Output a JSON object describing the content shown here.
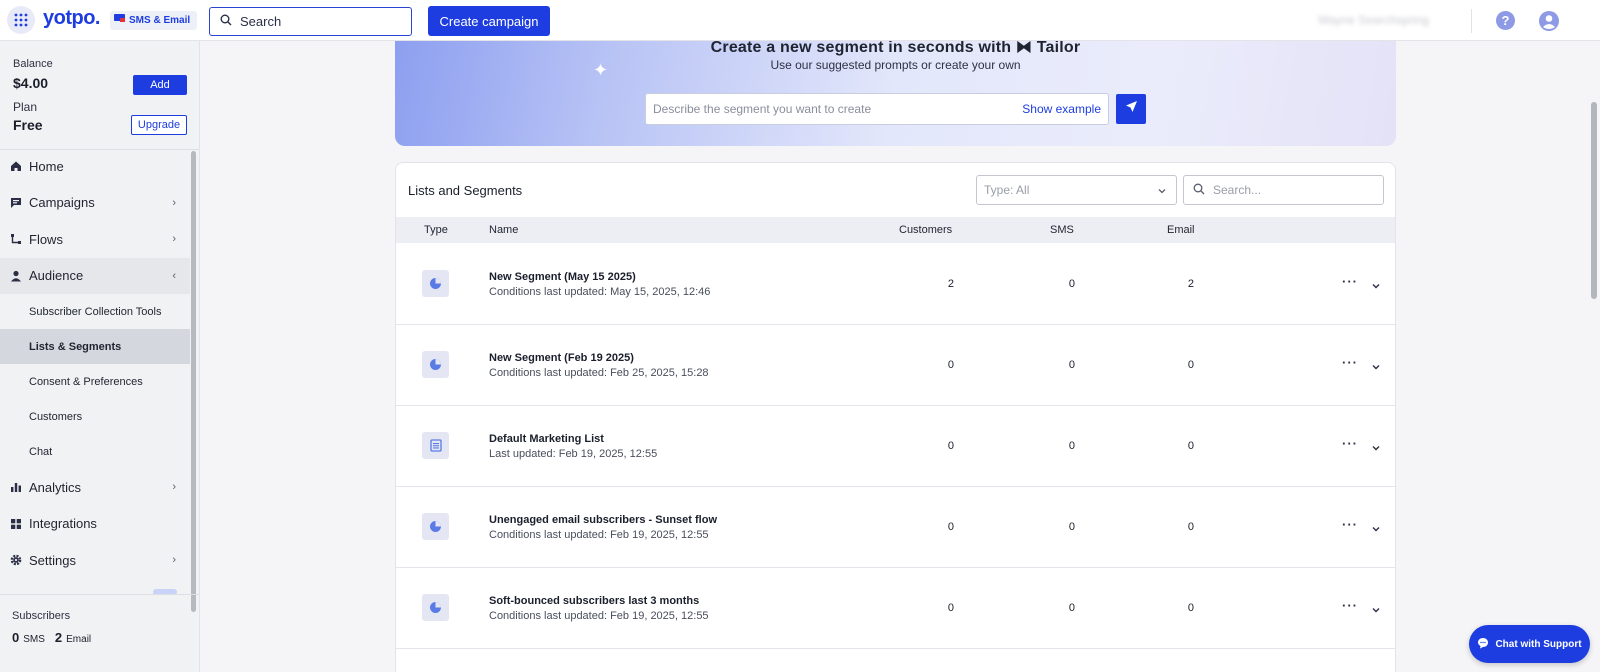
{
  "topbar": {
    "logo": "yotpo.",
    "product": "SMS & Email",
    "search_label": "Search",
    "create_campaign": "Create campaign",
    "user_name": "Wayne Searchspring"
  },
  "sidebar": {
    "balance_label": "Balance",
    "balance_value": "$4.00",
    "add_label": "Add",
    "plan_label": "Plan",
    "plan_value": "Free",
    "upgrade_label": "Upgrade",
    "nav": {
      "home": "Home",
      "campaigns": "Campaigns",
      "flows": "Flows",
      "audience": "Audience",
      "analytics": "Analytics",
      "integrations": "Integrations",
      "settings": "Settings"
    },
    "audience_sub": {
      "collection": "Subscriber Collection Tools",
      "lists": "Lists & Segments",
      "consent": "Consent & Preferences",
      "customers": "Customers",
      "chat": "Chat"
    },
    "subscribers_label": "Subscribers",
    "sms_count": "0",
    "sms_unit": "SMS",
    "email_count": "2",
    "email_unit": "Email"
  },
  "banner": {
    "title": "Create a new segment in seconds with ⧓ Tailor",
    "subtitle": "Use our suggested prompts or create your own",
    "prompt_placeholder": "Describe the segment you want to create",
    "show_example": "Show example"
  },
  "lists": {
    "title": "Lists and Segments",
    "type_filter": "Type: All",
    "search_placeholder": "Search...",
    "columns": {
      "type": "Type",
      "name": "Name",
      "customers": "Customers",
      "sms": "SMS",
      "email": "Email"
    },
    "rows": [
      {
        "icon": "segment-icon",
        "name": "New Segment (May 15 2025)",
        "sub": "Conditions last updated: May 15, 2025, 12:46",
        "customers": "2",
        "sms": "0",
        "email": "2"
      },
      {
        "icon": "segment-icon",
        "name": "New Segment (Feb 19 2025)",
        "sub": "Conditions last updated: Feb 25, 2025, 15:28",
        "customers": "0",
        "sms": "0",
        "email": "0"
      },
      {
        "icon": "list-icon",
        "name": "Default Marketing List",
        "sub": "Last updated: Feb 19, 2025, 12:55",
        "customers": "0",
        "sms": "0",
        "email": "0"
      },
      {
        "icon": "segment-icon",
        "name": "Unengaged email subscribers - Sunset flow",
        "sub": "Conditions last updated: Feb 19, 2025, 12:55",
        "customers": "0",
        "sms": "0",
        "email": "0"
      },
      {
        "icon": "segment-icon",
        "name": "Soft-bounced subscribers last 3 months",
        "sub": "Conditions last updated: Feb 19, 2025, 12:55",
        "customers": "0",
        "sms": "0",
        "email": "0"
      }
    ]
  },
  "chat": {
    "label": "Chat with Support"
  },
  "colors": {
    "accent": "#1d3de0",
    "sidebar_bg": "#f1f2f4",
    "active_item": "#d5d7de"
  }
}
